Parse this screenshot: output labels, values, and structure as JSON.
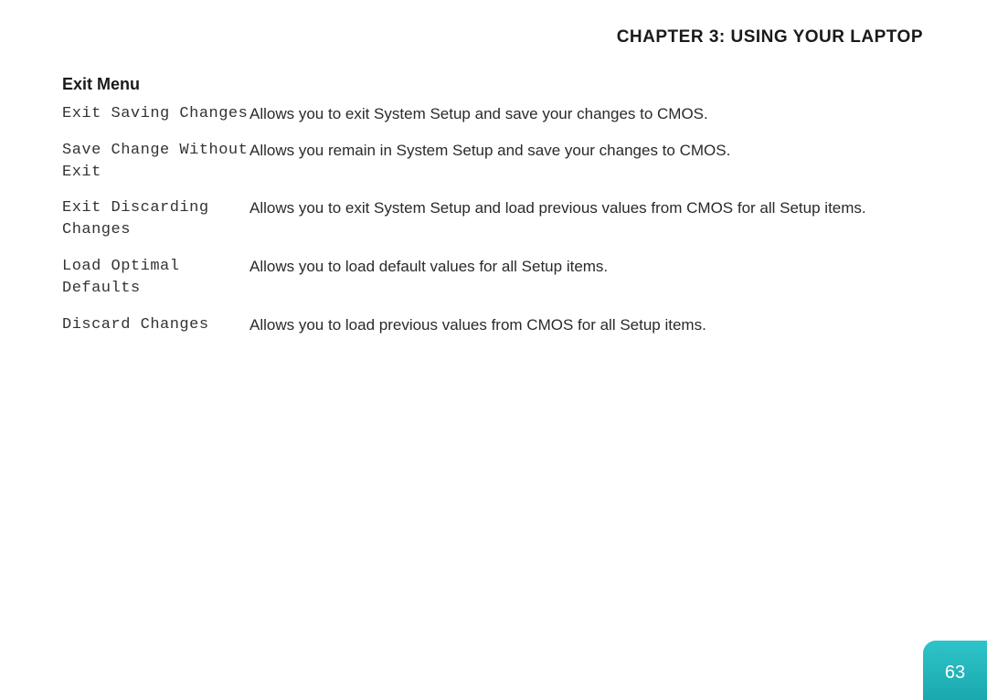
{
  "chapterTitle": "CHAPTER 3: USING YOUR LAPTOP",
  "sectionHeading": "Exit Menu",
  "rows": [
    {
      "term": "Exit Saving Changes",
      "desc": "Allows you to exit System Setup and save your changes to CMOS."
    },
    {
      "term": "Save Change Without Exit",
      "desc": "Allows you remain in System Setup and save your changes to CMOS."
    },
    {
      "term": "Exit Discarding Changes",
      "desc": "Allows you to exit System Setup and load previous values from CMOS for all Setup items."
    },
    {
      "term": "Load Optimal Defaults",
      "desc": "Allows you to load default values for all Setup items."
    },
    {
      "term": "Discard Changes",
      "desc": "Allows you to load previous values from CMOS for all Setup items."
    }
  ],
  "pageNumber": "63"
}
